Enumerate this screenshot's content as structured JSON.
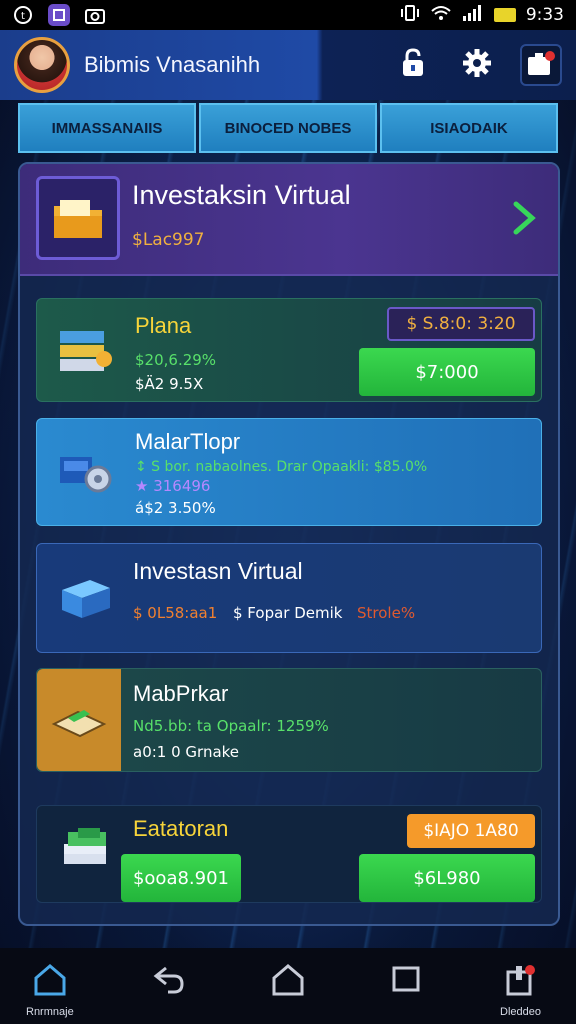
{
  "status_bar": {
    "time": "9:33",
    "left_icons": [
      "whatsapp-icon",
      "app-icon",
      "camera-icon"
    ],
    "right_icons": [
      "vibrate-icon",
      "wifi-icon",
      "signal-icon",
      "battery-icon"
    ]
  },
  "header": {
    "title": "Bibmis Vnasanihh",
    "icons": [
      "lock-icon",
      "gear-icon",
      "notification-box-icon"
    ]
  },
  "tabs": [
    {
      "label": "IMMASSANAIIS"
    },
    {
      "label": "BINOCED NOBES"
    },
    {
      "label": "ISIAODAIK"
    }
  ],
  "feature": {
    "title": "Investaksin Virtual",
    "value": "$Lac997",
    "colors": {
      "accent": "#4b3590",
      "arrow": "#37d65a"
    }
  },
  "cards": [
    {
      "title": "Plana",
      "line1": "$20,6.29%",
      "line2": "$Ä2 9.5X",
      "badge": "$ S.8:0: 3:20",
      "button": "$7:000"
    },
    {
      "title": "MalarTlopr",
      "line1": "↕ S bor. nabaolnes. Drar Opaakli: $85.0%",
      "line2": "★ 316496",
      "line3": "á$2 3.50%"
    },
    {
      "title": "Investasn Virtual",
      "line1_a": "$ 0L58:aa1",
      "line1_b": "$ Fopar Demik",
      "line1_c": "Strole%"
    },
    {
      "title": "MabPrkar",
      "line1": "Nd5.bb: ta Opaalr: 1259%",
      "line2": "a0:1 0 Grnake"
    },
    {
      "title": "Eatatoran",
      "badge": "$IAJO 1A80",
      "button_left": "$ooa8.901",
      "button_right": "$6L980"
    }
  ],
  "navbar": {
    "items": [
      {
        "label": "Rnrmnaje",
        "icon": "home-icon"
      },
      {
        "label": "",
        "icon": "back-icon"
      },
      {
        "label": "",
        "icon": "home-outline-icon"
      },
      {
        "label": "",
        "icon": "recent-apps-icon"
      },
      {
        "label": "Dleddeo",
        "icon": "notification-icon"
      }
    ]
  }
}
